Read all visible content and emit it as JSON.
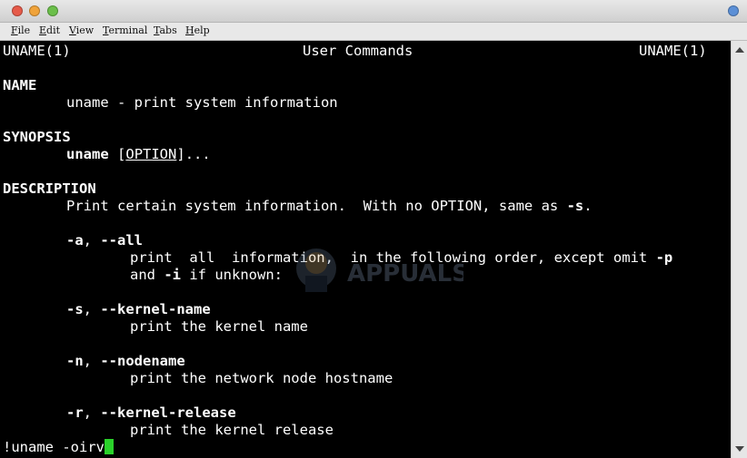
{
  "menu": {
    "items": [
      {
        "first": "F",
        "rest": "ile"
      },
      {
        "first": "E",
        "rest": "dit"
      },
      {
        "first": "V",
        "rest": "iew"
      },
      {
        "first": "T",
        "rest": "erminal"
      },
      {
        "first": "T",
        "rest": "abs"
      },
      {
        "first": "H",
        "rest": "elp"
      }
    ]
  },
  "terminal": {
    "header_left": "UNAME(1)",
    "header_center": "User Commands",
    "header_right": "UNAME(1)",
    "name_heading": "NAME",
    "name_text": "uname - print system information",
    "synopsis_heading": "SYNOPSIS",
    "synopsis_cmd": "uname",
    "synopsis_bracket_open": "[",
    "synopsis_option": "OPTION",
    "synopsis_tail": "]...",
    "description_heading": "DESCRIPTION",
    "description_prefix": "Print certain system information.  With no OPTION, same as ",
    "description_flag": "-s",
    "description_suffix": ".",
    "opt_all_short": "-a",
    "opt_all_long": "--all",
    "opt_all_desc1_prefix": "print  all  information,  in the following order, except omit ",
    "opt_all_desc1_flag": "-p",
    "opt_all_desc2_and": "and ",
    "opt_all_desc2_flag": "-i",
    "opt_all_desc2_suffix": " if unknown:",
    "opt_s_short": "-s",
    "opt_s_long": "--kernel-name",
    "opt_s_desc": "print the kernel name",
    "opt_n_short": "-n",
    "opt_n_long": "--nodename",
    "opt_n_desc": "print the network node hostname",
    "opt_r_short": "-r",
    "opt_r_long": "--kernel-release",
    "opt_r_desc": "print the kernel release",
    "prompt": "!uname -oirv"
  },
  "watermark": {
    "text": "APPUALS"
  },
  "colors": {
    "cursor": "#2ad12a",
    "background": "#000000",
    "foreground": "#ffffff"
  }
}
